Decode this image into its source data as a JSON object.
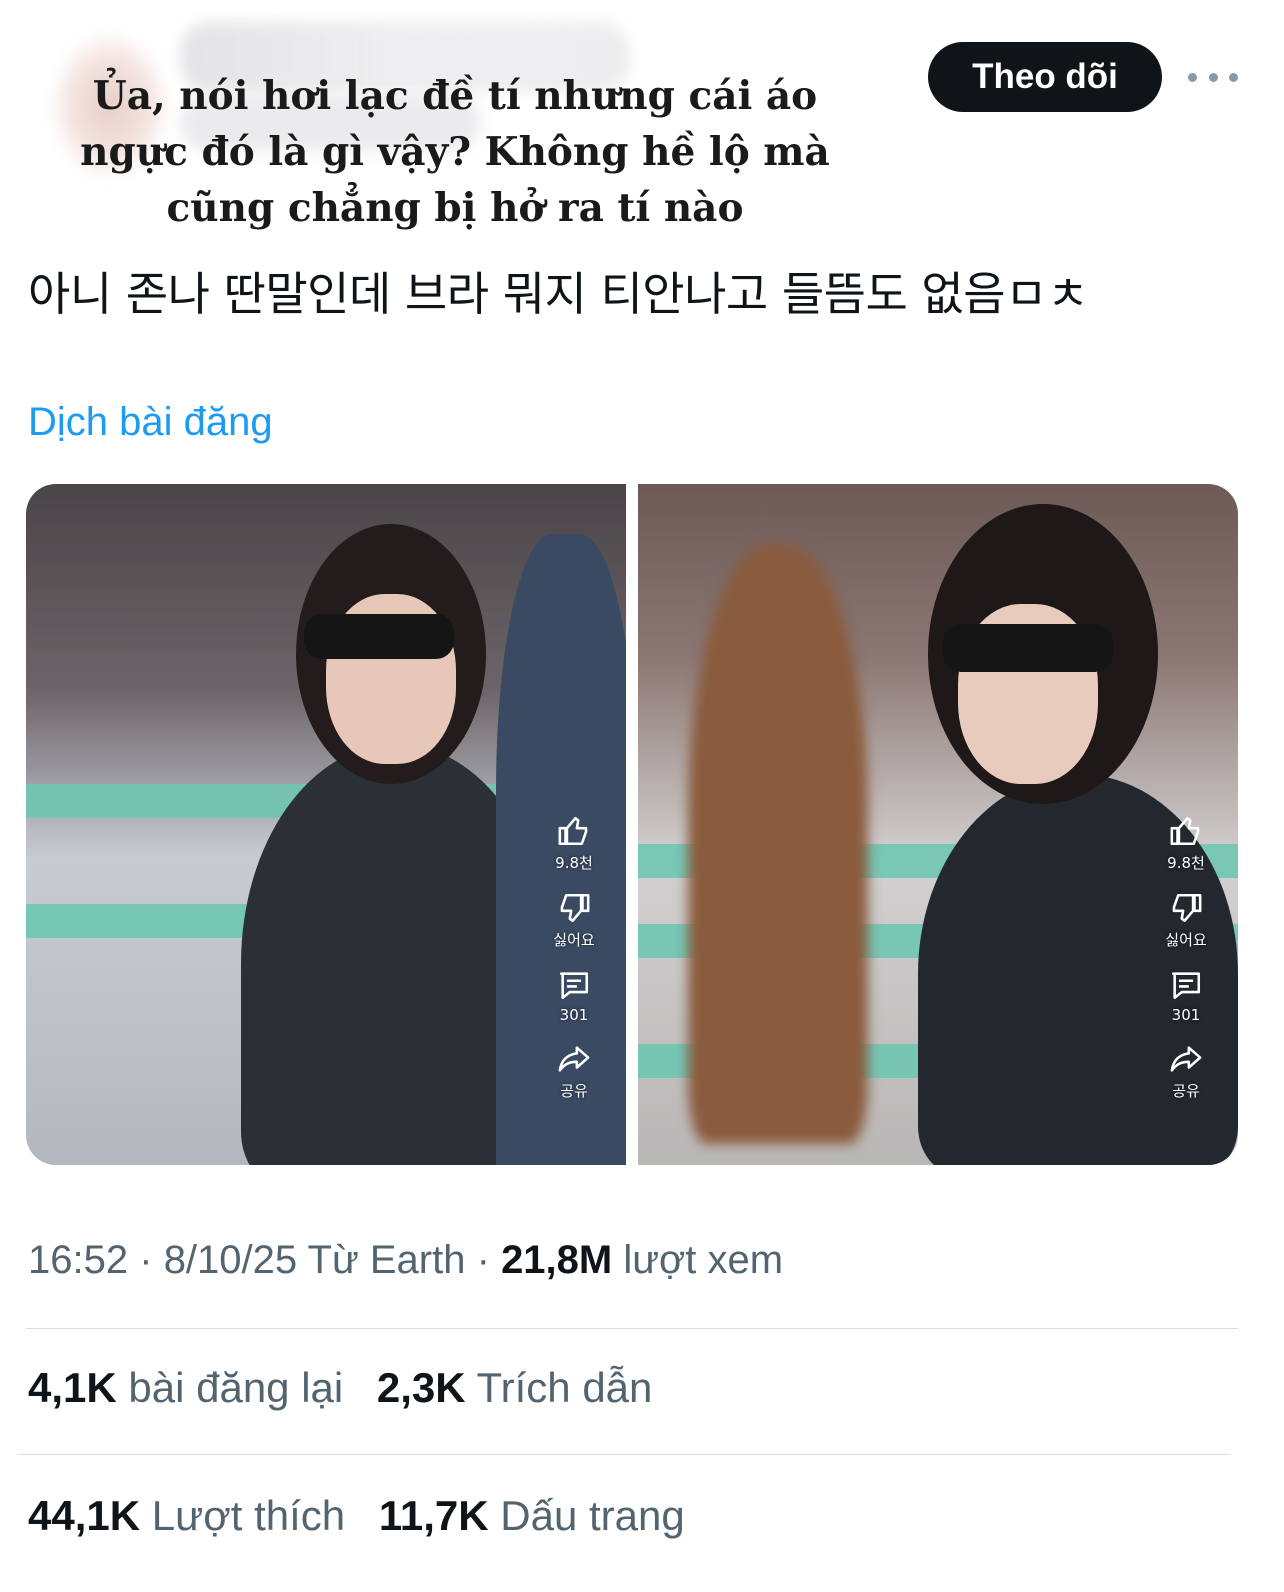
{
  "overlay_caption": "Ủa, nói hơi lạc đề tí nhưng cái áo ngực đó là gì vậy? Không hề lộ mà cũng chẳng bị hở ra tí nào",
  "header": {
    "follow_label": "Theo dõi",
    "more_icon": "more-horizontal-icon"
  },
  "post": {
    "text": "아니 존나 딴말인데 브라 뭐지 티안나고 들뜸도 없음ㅁㅊ",
    "translate_label": "Dịch bài đăng"
  },
  "media": [
    {
      "actions": {
        "like_count": "9.8천",
        "dislike_label": "싫어요",
        "comment_count": "301",
        "share_label": "공유"
      }
    },
    {
      "actions": {
        "like_count": "9.8천",
        "dislike_label": "싫어요",
        "comment_count": "301",
        "share_label": "공유"
      }
    }
  ],
  "meta": {
    "time": "16:52",
    "separator": "·",
    "date": "8/10/25",
    "source": "Từ Earth",
    "views_count": "21,8M",
    "views_label": "lượt xem"
  },
  "stats": {
    "reposts_count": "4,1K",
    "reposts_label": "bài đăng lại",
    "quotes_count": "2,3K",
    "quotes_label": "Trích dẫn",
    "likes_count": "44,1K",
    "likes_label": "Lượt thích",
    "bookmarks_count": "11,7K",
    "bookmarks_label": "Dấu trang"
  },
  "colors": {
    "link": "#1d9bf0",
    "secondary_text": "#536471",
    "follow_bg": "#0f1419"
  }
}
